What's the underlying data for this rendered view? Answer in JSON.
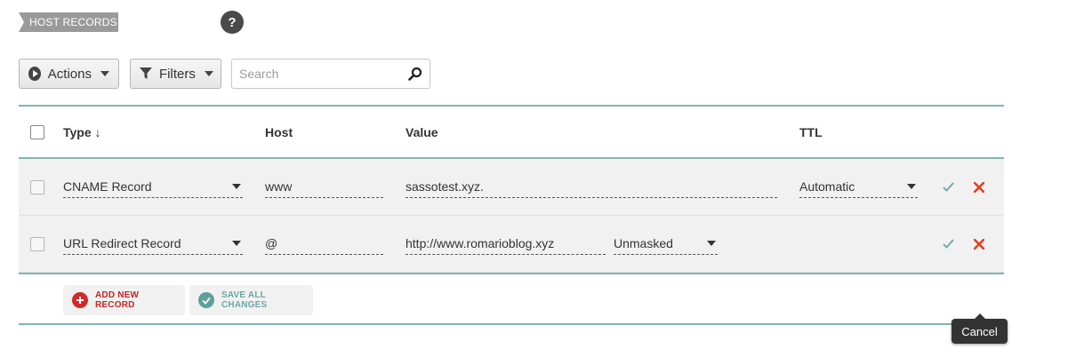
{
  "section": {
    "title": "HOST RECORDS",
    "help_label": "?"
  },
  "toolbar": {
    "actions_label": "Actions",
    "filters_label": "Filters",
    "search_placeholder": "Search"
  },
  "table": {
    "headers": {
      "type": "Type ↓",
      "host": "Host",
      "value": "Value",
      "ttl": "TTL"
    },
    "rows": [
      {
        "type": "CNAME Record",
        "host": "www",
        "value": "sassotest.xyz.",
        "ttl": "Automatic"
      },
      {
        "type": "URL Redirect Record",
        "host": "@",
        "value": "http://www.romarioblog.xyz",
        "redirect_mode": "Unmasked"
      }
    ]
  },
  "footer": {
    "add_label": "ADD NEW RECORD",
    "save_label": "SAVE ALL CHANGES"
  },
  "tooltip": {
    "text": "Cancel"
  },
  "colors": {
    "accent_teal": "#6aa9a3",
    "delete_red": "#e0411f",
    "add_red": "#c32626"
  }
}
